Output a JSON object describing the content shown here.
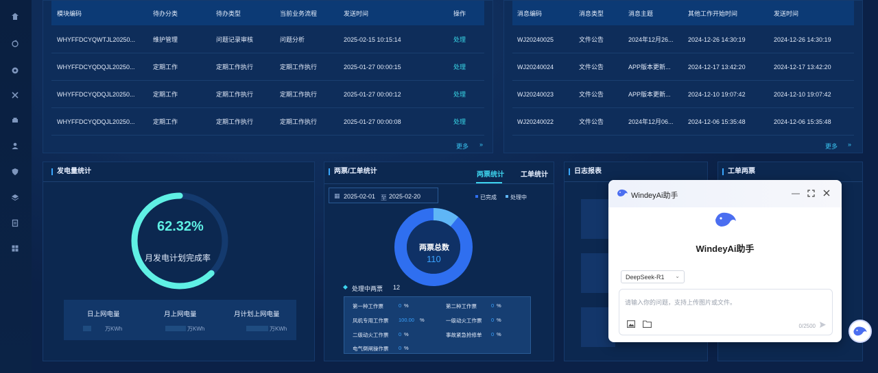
{
  "todo_table": {
    "headers": [
      "模块编码",
      "待办分类",
      "待办类型",
      "当前业务流程",
      "发送时间",
      "操作"
    ],
    "rows": [
      [
        "WHYFFDCYQWTJL20250...",
        "维护管理",
        "问题记录审核",
        "问题分析",
        "2025-02-15 10:15:14",
        "处理"
      ],
      [
        "WHYFFDCYQDQJL20250...",
        "定期工作",
        "定期工作执行",
        "定期工作执行",
        "2025-01-27 00:00:15",
        "处理"
      ],
      [
        "WHYFFDCYQDQJL20250...",
        "定期工作",
        "定期工作执行",
        "定期工作执行",
        "2025-01-27 00:00:12",
        "处理"
      ],
      [
        "WHYFFDCYQDQJL20250...",
        "定期工作",
        "定期工作执行",
        "定期工作执行",
        "2025-01-27 00:00:08",
        "处理"
      ]
    ],
    "more": "更多"
  },
  "message_table": {
    "headers": [
      "消息编码",
      "消息类型",
      "消息主题",
      "其他工作开始时间",
      "发送时间"
    ],
    "rows": [
      [
        "WJ20240025",
        "文件公告",
        "2024年12月26...",
        "2024-12-26 14:30:19",
        "2024-12-26 14:30:19"
      ],
      [
        "WJ20240024",
        "文件公告",
        "APP版本更新...",
        "2024-12-17 13:42:20",
        "2024-12-17 13:42:20"
      ],
      [
        "WJ20240023",
        "文件公告",
        "APP版本更新...",
        "2024-12-10 19:07:42",
        "2024-12-10 19:07:42"
      ],
      [
        "WJ20240022",
        "文件公告",
        "2024年12月06...",
        "2024-12-06 15:35:48",
        "2024-12-06 15:35:48"
      ]
    ],
    "more": "更多"
  },
  "power": {
    "title": "发电量统计",
    "gauge_value": "62.32%",
    "gauge_fraction": 0.6232,
    "gauge_label": "月发电计划完成率",
    "stats": [
      {
        "label": "日上网电量",
        "unit": "万KWh"
      },
      {
        "label": "月上网电量",
        "unit": "万KWh"
      },
      {
        "label": "月计划上网电量",
        "unit": "万KWh"
      }
    ]
  },
  "tickets": {
    "title": "两票/工单统计",
    "tabs": [
      "两票统计",
      "工单统计"
    ],
    "date_from": "2025-02-01",
    "date_sep": "至",
    "date_to": "2025-02-20",
    "legend": [
      "已完成",
      "处理中"
    ],
    "donut_label": "两票总数",
    "donut_total": "110",
    "processing_label": "处理中两票",
    "processing_count": "12",
    "items": [
      {
        "name": "第一种工作票",
        "value": "0",
        "unit": "%"
      },
      {
        "name": "第二种工作票",
        "value": "0",
        "unit": "%"
      },
      {
        "name": "风机专用工作票",
        "value": "100.00",
        "unit": "%"
      },
      {
        "name": "一级动火工作票",
        "value": "0",
        "unit": "%"
      },
      {
        "name": "二级动火工作票",
        "value": "0",
        "unit": "%"
      },
      {
        "name": "事故紧急抢修单",
        "value": "0",
        "unit": "%"
      },
      {
        "name": "电气倒闸操作票",
        "value": "0",
        "unit": "%"
      }
    ],
    "colors": {
      "done": "#2f6ff0",
      "processing": "#5fb6f6"
    }
  },
  "log_report": {
    "title": "日志报表"
  },
  "work_tickets": {
    "title": "工单两票"
  },
  "ai": {
    "header_title": "WindeyAi助手",
    "big_title": "WindeyAi助手",
    "model": "DeepSeek-R1",
    "placeholder": "请输入你的问题，支持上传图片或文件。",
    "counter": "0/2500"
  }
}
